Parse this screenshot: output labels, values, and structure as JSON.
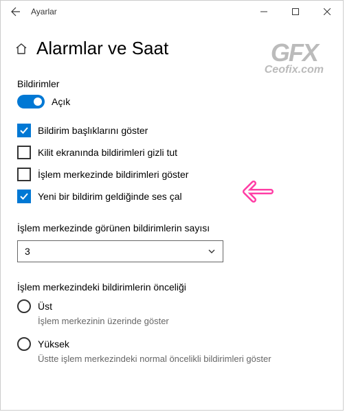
{
  "window": {
    "title": "Ayarlar"
  },
  "page": {
    "title": "Alarmlar ve Saat"
  },
  "notifications": {
    "section_label": "Bildirimler",
    "toggle_state": "Açık",
    "checkboxes": [
      {
        "label": "Bildirim başlıklarını göster",
        "checked": true
      },
      {
        "label": "Kilit ekranında bildirimleri gizli tut",
        "checked": false
      },
      {
        "label": "İşlem merkezinde bildirimleri göster",
        "checked": false
      },
      {
        "label": "Yeni bir bildirim geldiğinde ses çal",
        "checked": true
      }
    ]
  },
  "action_center_count": {
    "label": "İşlem merkezinde görünen bildirimlerin sayısı",
    "value": "3"
  },
  "priority": {
    "label": "İşlem merkezindeki bildirimlerin önceliği",
    "options": [
      {
        "label": "Üst",
        "desc": "İşlem merkezinin üzerinde göster"
      },
      {
        "label": "Yüksek",
        "desc": "Üstte işlem merkezindeki normal öncelikli bildirimleri göster"
      }
    ]
  },
  "watermark": {
    "line1": "GFX",
    "line2": "Ceofix.com"
  }
}
